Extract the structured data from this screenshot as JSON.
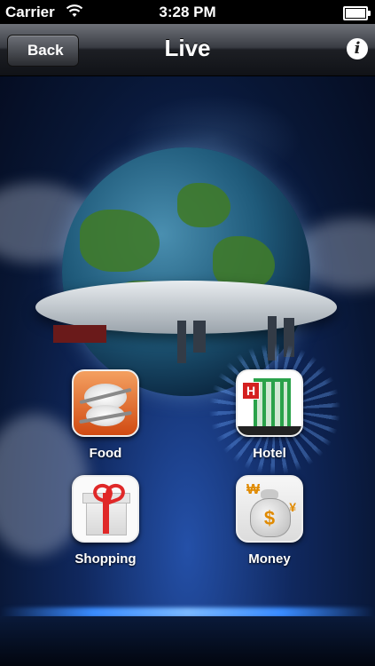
{
  "status_bar": {
    "carrier": "Carrier",
    "time": "3:28 PM"
  },
  "nav": {
    "back_label": "Back",
    "title": "Live",
    "info_label": "i"
  },
  "apps": [
    {
      "label": "Food",
      "icon": "plate-icon"
    },
    {
      "label": "Hotel",
      "icon": "hotel-icon",
      "sign": "H"
    },
    {
      "label": "Shopping",
      "icon": "gift-icon"
    },
    {
      "label": "Money",
      "icon": "money-bag-icon",
      "symbols": [
        "₩",
        "$",
        "¥"
      ]
    }
  ],
  "colors": {
    "accent_glow": "#3a8cff",
    "background": "#10285e"
  }
}
